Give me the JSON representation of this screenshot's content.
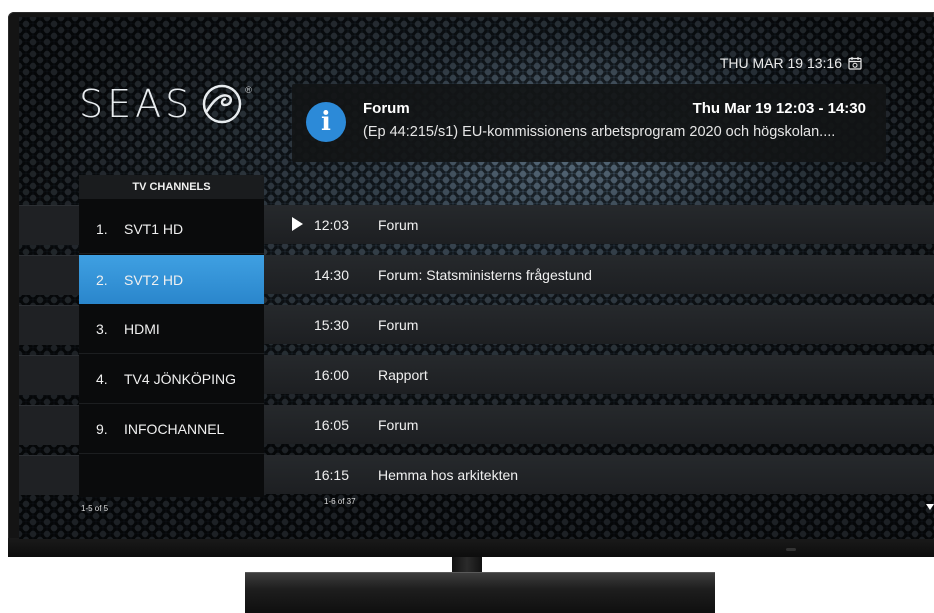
{
  "clock": {
    "text": "THU MAR 19 13:16"
  },
  "logo": {
    "text": "SEAS",
    "reg": "®"
  },
  "info": {
    "icon": "i",
    "title": "Forum",
    "time": "Thu Mar 19 12:03 - 14:30",
    "description": "(Ep 44:215/s1) EU-kommissionens arbetsprogram 2020 och högskolan...."
  },
  "channels": {
    "header": "TV CHANNELS",
    "items": [
      {
        "num": "1.",
        "name": "SVT1 HD",
        "selected": false
      },
      {
        "num": "2.",
        "name": "SVT2 HD",
        "selected": true
      },
      {
        "num": "3.",
        "name": "HDMI",
        "selected": false
      },
      {
        "num": "4.",
        "name": "TV4 JÖNKÖPING",
        "selected": false
      },
      {
        "num": "9.",
        "name": "INFOCHANNEL",
        "selected": false
      }
    ],
    "counter": "1-5 of 5"
  },
  "programs": {
    "items": [
      {
        "time": "12:03",
        "title": "Forum",
        "playing": true
      },
      {
        "time": "14:30",
        "title": "Forum: Statsministerns frågestund",
        "playing": false
      },
      {
        "time": "15:30",
        "title": "Forum",
        "playing": false
      },
      {
        "time": "16:00",
        "title": "Rapport",
        "playing": false
      },
      {
        "time": "16:05",
        "title": "Forum",
        "playing": false
      },
      {
        "time": "16:15",
        "title": "Hemma hos arkitekten",
        "playing": false
      }
    ],
    "counter": "1-6 of 37"
  },
  "colors": {
    "accent": "#2c8ad8",
    "selected": "#3a98dc"
  }
}
